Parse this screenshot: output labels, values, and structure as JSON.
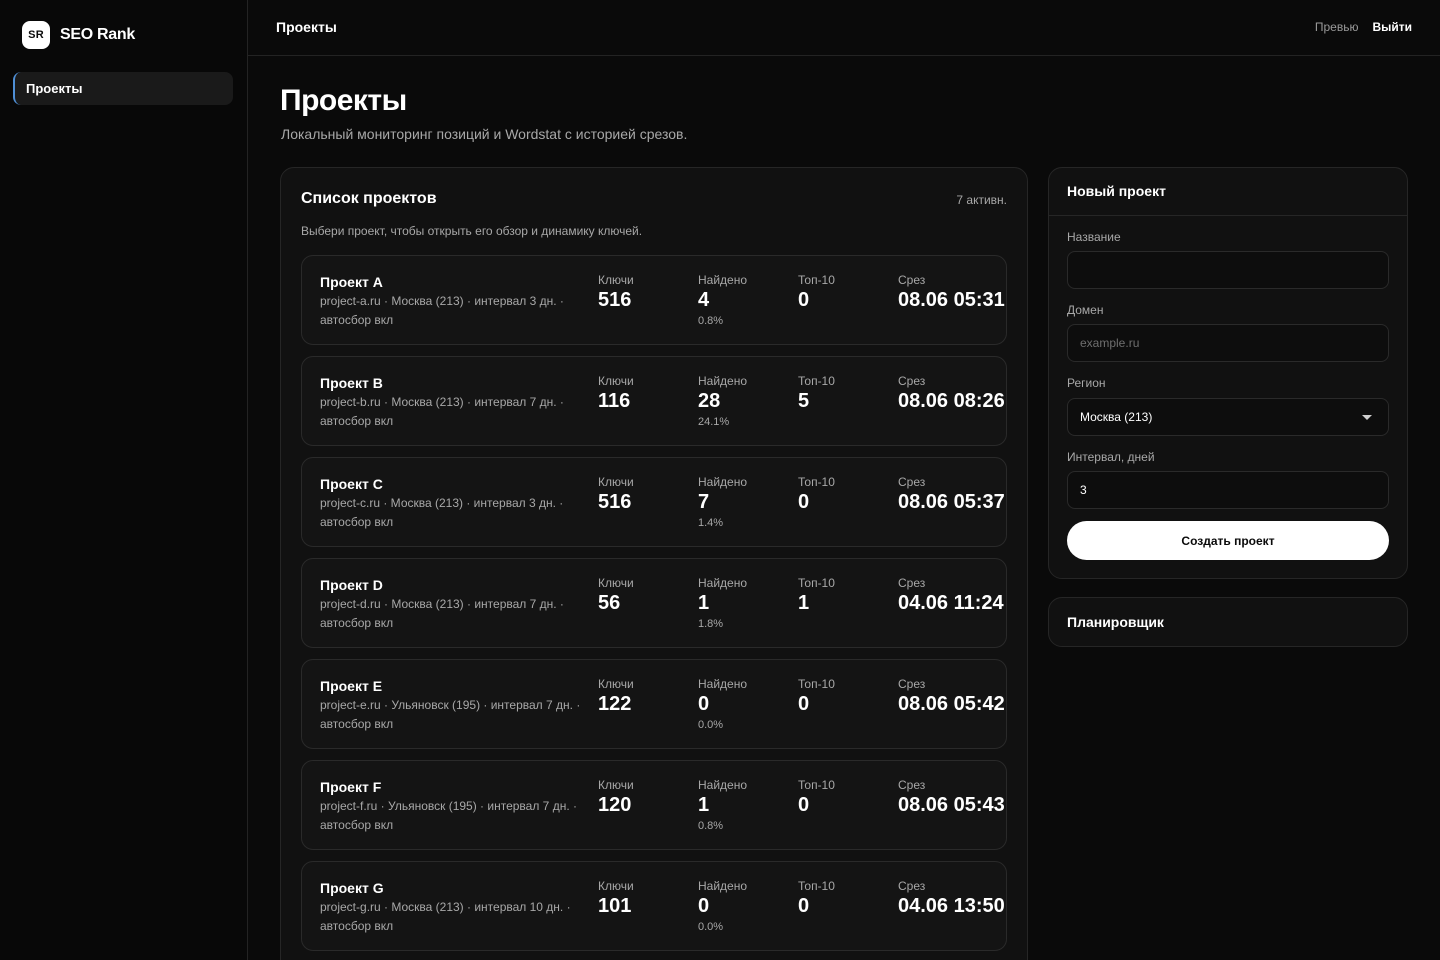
{
  "brand": {
    "logo": "SR",
    "name": "SEO Rank"
  },
  "sidebar": {
    "items": [
      {
        "label": "Проекты"
      }
    ]
  },
  "topbar": {
    "title": "Проекты",
    "preview": "Превью",
    "logout": "Выйти"
  },
  "header": {
    "title": "Проекты",
    "subtitle": "Локальный мониторинг позиций и Wordstat с историей срезов."
  },
  "projects_panel": {
    "title": "Список проектов",
    "count": "7 активн.",
    "hint": "Выбери проект, чтобы открыть его обзор и динамику ключей.",
    "labels": {
      "keys": "Ключи",
      "found": "Найдено",
      "top10": "Топ-10",
      "cut": "Срез"
    },
    "projects": [
      {
        "name": "Проект A",
        "meta": "project-a.ru · Москва (213) · интервал 3 дн. · автосбор вкл",
        "keys": "516",
        "found": "4",
        "found_pct": "0.8%",
        "top10": "0",
        "cut": "08.06 05:31"
      },
      {
        "name": "Проект B",
        "meta": "project-b.ru · Москва (213) · интервал 7 дн. · автосбор вкл",
        "keys": "116",
        "found": "28",
        "found_pct": "24.1%",
        "top10": "5",
        "cut": "08.06 08:26"
      },
      {
        "name": "Проект C",
        "meta": "project-c.ru · Москва (213) · интервал 3 дн. · автосбор вкл",
        "keys": "516",
        "found": "7",
        "found_pct": "1.4%",
        "top10": "0",
        "cut": "08.06 05:37"
      },
      {
        "name": "Проект D",
        "meta": "project-d.ru · Москва (213) · интервал 7 дн. · автосбор вкл",
        "keys": "56",
        "found": "1",
        "found_pct": "1.8%",
        "top10": "1",
        "cut": "04.06 11:24"
      },
      {
        "name": "Проект E",
        "meta": "project-e.ru · Ульяновск (195) · интервал 7 дн. · автосбор вкл",
        "keys": "122",
        "found": "0",
        "found_pct": "0.0%",
        "top10": "0",
        "cut": "08.06 05:42"
      },
      {
        "name": "Проект F",
        "meta": "project-f.ru · Ульяновск (195) · интервал 7 дн. · автосбор вкл",
        "keys": "120",
        "found": "1",
        "found_pct": "0.8%",
        "top10": "0",
        "cut": "08.06 05:43"
      },
      {
        "name": "Проект G",
        "meta": "project-g.ru · Москва (213) · интервал 10 дн. · автосбор вкл",
        "keys": "101",
        "found": "0",
        "found_pct": "0.0%",
        "top10": "0",
        "cut": "04.06 13:50"
      }
    ]
  },
  "new_project": {
    "title": "Новый проект",
    "name_label": "Название",
    "name_value": "",
    "domain_label": "Домен",
    "domain_placeholder": "example.ru",
    "region_label": "Регион",
    "region_value": "Москва (213)",
    "interval_label": "Интервал, дней",
    "interval_value": "3",
    "submit": "Создать проект"
  },
  "scheduler": {
    "title": "Планировщик"
  },
  "colors": {
    "background": "#0a0a0a",
    "panel": "#111111",
    "border": "#262626",
    "accent": "#4f8fd6",
    "muted": "#a8a8a8"
  }
}
